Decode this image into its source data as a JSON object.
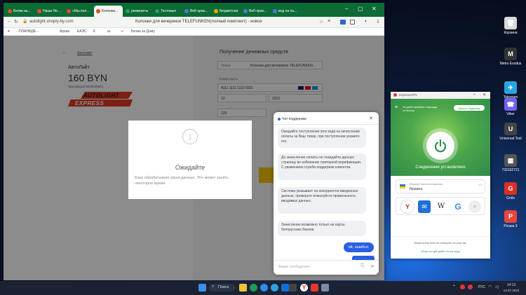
{
  "desktop": {
    "icons": [
      {
        "label": "Корзина",
        "color": "#d9d9d9",
        "glyph": "🗑"
      },
      {
        "label": "Metro Exodus",
        "color": "#333333",
        "glyph": "M"
      },
      {
        "label": "Telegram",
        "color": "#2aa3e0",
        "glyph": "✈"
      },
      {
        "label": "Viber",
        "color": "#7360f2",
        "glyph": "☎"
      },
      {
        "label": "Universal Tool",
        "color": "#444444",
        "glyph": "U"
      },
      {
        "label": "733162721",
        "color": "#555555",
        "glyph": "▦"
      },
      {
        "label": "Grids",
        "color": "#d93025",
        "glyph": "G"
      },
      {
        "label": "Picasa 3",
        "color": "#e8453c",
        "glyph": "P"
      }
    ]
  },
  "browser": {
    "tabs": [
      {
        "label": "Битва за...",
        "color": "#e34c26"
      },
      {
        "label": "Наша Не...",
        "color": "#e34c26"
      },
      {
        "label": "«Мы пол...",
        "color": "#e34c26"
      },
      {
        "label": "Колонки...",
        "color": "#e34c26"
      },
      {
        "label": "реквизиты",
        "color": "#25a25a"
      },
      {
        "label": "Тестовые",
        "color": "#25a25a"
      },
      {
        "label": "Веб-хран...",
        "color": "#4c7bd9"
      },
      {
        "label": "Бюджетная",
        "color": "#f2a900"
      },
      {
        "label": "Веб-хран...",
        "color": "#4c7bd9"
      },
      {
        "label": "вод на па...",
        "color": "#4c7bd9"
      }
    ],
    "url": "autolight.shoply-by.com",
    "page_title_in_bar": "Колонки для вечеринок TELEFUNKEN(полный комплект) - новое",
    "bookmarks": [
      "Архив",
      "ЕАЭС",
      "К",
      "ai",
      "v",
      "Битва за Дому"
    ],
    "bookmark_prefix": "∙∙∙ПЛАНИДЕ∙∙∙"
  },
  "checkout": {
    "back_link": "Автолайт",
    "company": "АвтоЛайт",
    "amount": "160 BYN",
    "transaction": "Транзакция 9250536861",
    "logo_top": "AUTOLIGHT",
    "logo_bottom": "EXPRESS",
    "receive_title": "Получение денежных средств",
    "product_label": "Товар",
    "product_value": "Колонки для вечеринок TELEFUNKEN...",
    "card_label": "Номер карты",
    "card_number": "4111 1111 1110 5021",
    "month": "12",
    "year": "2023",
    "cvv": "123"
  },
  "modal": {
    "title": "Ожидайте",
    "text": "Банк обрабатывает ваши данные. Это может занять некоторое время",
    "icon": "info-icon"
  },
  "chat": {
    "title": "Чат поддержки",
    "messages": [
      "Ожидайте поступления sms кода на зачисление оплаты за Ваш товар, при поступлении укажите его.",
      "До зачисления оплаты не покидайте данную страницу во избежание повторной верификации. С уважением служба поддержки клиентов.",
      "Система указывает на некорректно введенные данные, проверьте пожалуйста правильность вводимых данных.",
      "Зачисление возможно только на карты белорусских банков."
    ],
    "user_message": "ой, ошибся.",
    "input_placeholder": "Ваше сообщение..."
  },
  "vpn": {
    "title": "ExpressVPN",
    "promo": "10 дней пробного периода осталось",
    "subscribe_button": "Купить подписку",
    "status": "Соединение установлено",
    "location_caption": "Текущее местоположение",
    "location": "Украина",
    "shortcuts": [
      "yandex-icon",
      "mail-icon",
      "wikipedia-icon",
      "google-icon",
      "add-icon"
    ],
    "tagline": "Smart home tech for everyone on your list.",
    "guide_link": "Read our gift guide on our blog",
    "accent": "#da3940",
    "green": "#2f8d4a"
  },
  "taskbar": {
    "search": "Поиск",
    "lang": "РУС",
    "time": "14:13",
    "date": "13.07.2023"
  }
}
